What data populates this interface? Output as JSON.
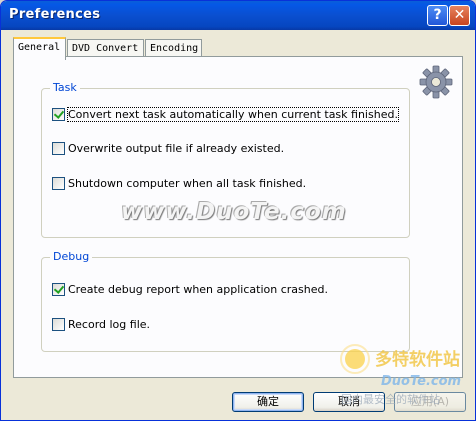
{
  "window": {
    "title": "Preferences",
    "help_glyph": "?",
    "close_glyph": "✕"
  },
  "tabs": [
    {
      "label": "General",
      "active": true
    },
    {
      "label": "DVD Convert",
      "active": false
    },
    {
      "label": "Encoding",
      "active": false
    }
  ],
  "groups": {
    "task": {
      "label": "Task",
      "options": [
        {
          "label": "Convert next task automatically when current task finished.",
          "checked": true
        },
        {
          "label": "Overwrite output file if already existed.",
          "checked": false
        },
        {
          "label": "Shutdown computer when all task finished.",
          "checked": false
        }
      ]
    },
    "debug": {
      "label": "Debug",
      "options": [
        {
          "label": "Create debug report when application crashed.",
          "checked": true
        },
        {
          "label": "Record log file.",
          "checked": false
        }
      ]
    }
  },
  "watermark": "www.DuoTe.com",
  "logo": {
    "line1": "多特软件站",
    "line2": "DuoTe.com",
    "line3": "国内最安全的软件站"
  },
  "buttons": {
    "ok": "确定",
    "cancel": "取消",
    "apply": "应用(A)"
  },
  "icons": {
    "settings": "gear-icon",
    "help": "help-icon",
    "close": "close-icon"
  },
  "colors": {
    "titlebar": "#0a4fd0",
    "group_label": "#0046d5",
    "check": "#21a121",
    "tab_highlight": "#ffc83c"
  }
}
